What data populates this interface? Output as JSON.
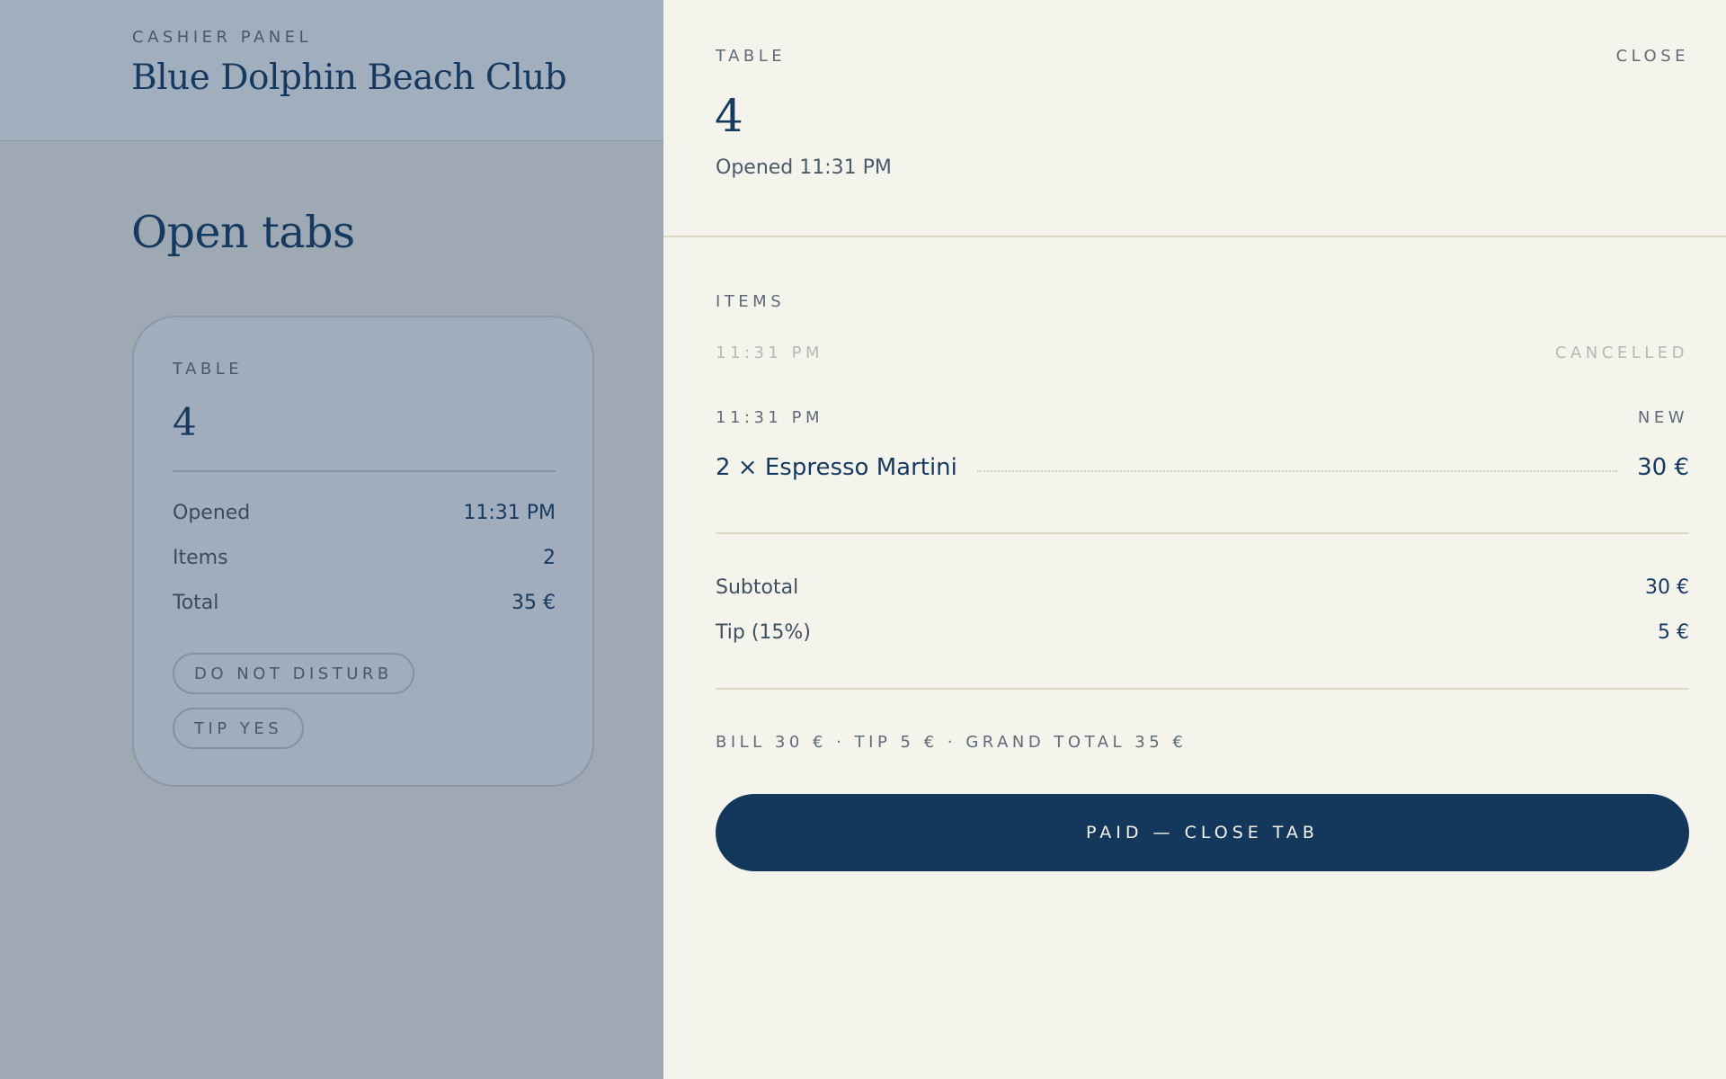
{
  "sidebar": {
    "kicker": "CASHIER PANEL",
    "venue": "Blue Dolphin Beach Club",
    "heading": "Open tabs",
    "tab_card": {
      "kicker": "TABLE",
      "number": "4",
      "rows": [
        {
          "label": "Opened",
          "value": "11:31 PM"
        },
        {
          "label": "Items",
          "value": "2"
        },
        {
          "label": "Total",
          "value": "35 €"
        }
      ],
      "tags": [
        "DO NOT DISTURB",
        "TIP YES"
      ]
    }
  },
  "drawer": {
    "kicker": "TABLE",
    "close_label": "CLOSE",
    "number": "4",
    "opened": "Opened 11:31 PM",
    "items_heading": "ITEMS",
    "entries": [
      {
        "time": "11:31 PM",
        "status": "CANCELLED"
      },
      {
        "time": "11:31 PM",
        "status": "NEW",
        "line": "2 × Espresso Martini",
        "price": "30 €"
      }
    ],
    "subtotal": {
      "label": "Subtotal",
      "value": "30 €"
    },
    "tip": {
      "label": "Tip (15%)",
      "value": "5 €"
    },
    "summary": "BILL 30 € · TIP 5 € · GRAND TOTAL 35 €",
    "pay_label": "PAID — CLOSE TAB"
  },
  "colors": {
    "navy": "#14385b",
    "cream": "#f5f4ec",
    "overlay_slate": "#9ea9b3",
    "muted_text": "#b6b9b3"
  }
}
